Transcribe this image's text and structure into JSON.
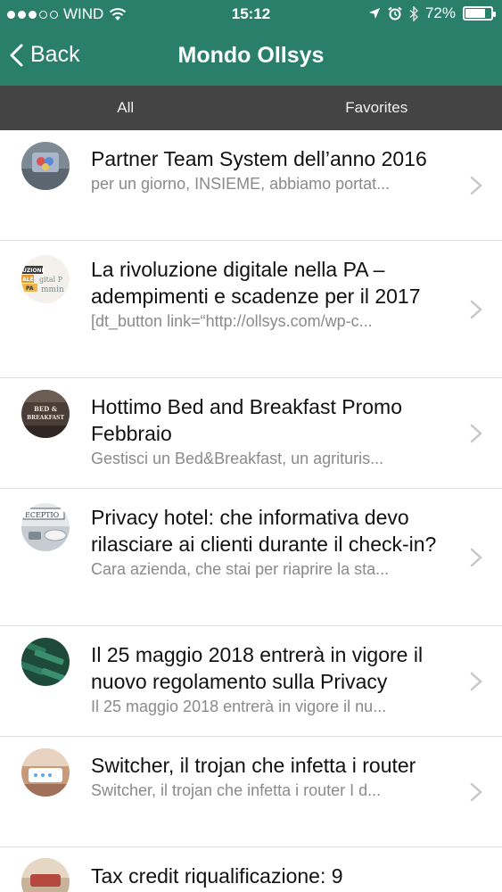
{
  "status_bar": {
    "carrier": "WIND",
    "time": "15:12",
    "battery": "72%",
    "battery_level": 0.72,
    "icons": [
      "signal-dots-icon",
      "wifi-icon",
      "location-arrow-icon",
      "alarm-icon",
      "bluetooth-icon",
      "battery-icon"
    ]
  },
  "nav": {
    "back_label": "Back",
    "title": "Mondo Ollsys"
  },
  "tabs": [
    {
      "label": "All"
    },
    {
      "label": "Favorites"
    }
  ],
  "colors": {
    "header": "#2a7f6b",
    "tab_bar": "#444444",
    "title_text": "#111111",
    "subtitle_text": "#8a8a8a",
    "separator": "#dedede"
  },
  "articles": [
    {
      "title": "Partner Team System dell’anno 2016",
      "subtitle": "per un giorno, INSIEME, abbiamo portat..."
    },
    {
      "title": "La rivoluzione digitale nella PA – adempimenti e scadenze per il 2017",
      "subtitle": "[dt_button link=“http://ollsys.com/wp-c...",
      "thumb_text": [
        "UZIONE",
        "ALE",
        "gital P",
        "PA",
        "mmin"
      ]
    },
    {
      "title": "Hottimo Bed and Breakfast Promo Febbraio",
      "subtitle": "Gestisci un Bed&Breakfast, un agrituris...",
      "thumb_text": [
        "BED &",
        "BREAKFAST"
      ]
    },
    {
      "title": "Privacy hotel: che informativa devo rilasciare ai clienti durante il check-in?",
      "subtitle": "Cara azienda, che stai per riaprire la sta...",
      "thumb_text": [
        "ECEPTIO"
      ]
    },
    {
      "title": "Il 25 maggio 2018 entrerà in vigore il nuovo regolamento sulla Privacy",
      "subtitle": "Il 25 maggio 2018 entrerà in vigore il nu..."
    },
    {
      "title": "Switcher, il trojan che infetta i router",
      "subtitle": "Switcher, il trojan che infetta i router I d..."
    },
    {
      "title": "Tax credit riqualificazione: 9",
      "subtitle": ""
    }
  ]
}
